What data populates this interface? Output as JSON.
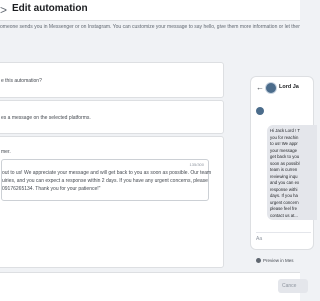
{
  "header": {
    "back_arrow": ">",
    "title": "Edit automation"
  },
  "description": "omeone sends you in Messenger or on Instagram. You can customize your message to say hello, give them more information or let them know wi",
  "card1": {
    "question": "e this automation?"
  },
  "card2": {
    "text": "es a message on the selected platforms."
  },
  "card3": {
    "label": "mer.",
    "counter": "135/300",
    "message_lines": [
      "out to us! We appreciate your message and will get back to you as soon as possible. Our team",
      "uiries, and you can expect a response within 2 days. If you have any urgent concerns, please",
      "09176265134. Thank you for your patience!\""
    ]
  },
  "preview": {
    "back_icon": "←",
    "name": "Lord Ja",
    "bubble_lines": [
      "Hi Jack Lord ! T",
      "you for reachin",
      "to us! We appr",
      "your message",
      "get back to you",
      "soon as possibl",
      "team is curren",
      "reviewing inqu",
      "and you can ex",
      "response withi",
      "days. If you ha",
      "urgent concern",
      "please feel fre",
      "contact us at..."
    ],
    "input_placeholder": "Aa",
    "button_label": "Preview in Mes"
  },
  "footer": {
    "cancel_label": "Cance"
  }
}
